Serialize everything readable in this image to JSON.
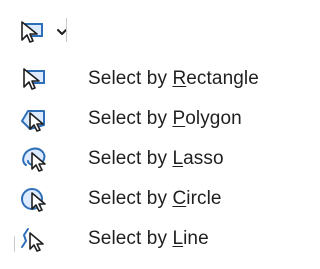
{
  "toolbar": {
    "tool_icon": "select-rectangle-icon",
    "dropdown_icon": "chevron-down-icon"
  },
  "menu": {
    "items": [
      {
        "icon": "select-rectangle-icon",
        "prefix": "Select by ",
        "accel": "R",
        "suffix": "ectangle"
      },
      {
        "icon": "select-polygon-icon",
        "prefix": "Select by ",
        "accel": "P",
        "suffix": "olygon"
      },
      {
        "icon": "select-lasso-icon",
        "prefix": "Select by ",
        "accel": "L",
        "suffix": "asso"
      },
      {
        "icon": "select-circle-icon",
        "prefix": "Select by ",
        "accel": "C",
        "suffix": "ircle"
      },
      {
        "icon": "select-line-icon",
        "prefix": "Select by ",
        "accel": "L",
        "suffix": "ine"
      }
    ]
  },
  "colors": {
    "text": "#1f1f1f",
    "icon_blue": "#2f6fb8",
    "icon_gray": "#666666",
    "separator": "#c8c8c8"
  }
}
